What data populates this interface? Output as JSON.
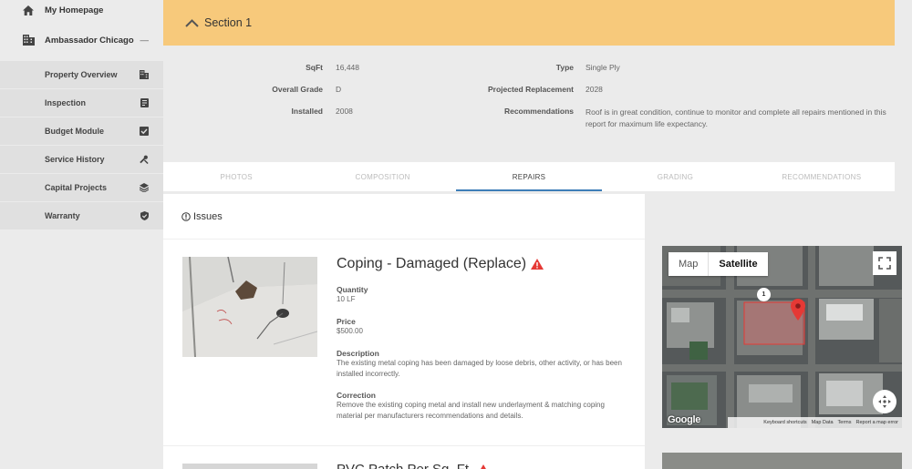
{
  "sidebar": {
    "top_items": [
      {
        "label": "My Homepage",
        "icon": "home-icon"
      },
      {
        "label": "Ambassador Chicago",
        "icon": "building-icon",
        "toggle": "—"
      }
    ],
    "items": [
      {
        "label": "Property Overview",
        "icon": "building-small-icon"
      },
      {
        "label": "Inspection",
        "icon": "clipboard-icon"
      },
      {
        "label": "Budget Module",
        "icon": "checkbox-icon"
      },
      {
        "label": "Service History",
        "icon": "wrench-icon"
      },
      {
        "label": "Capital Projects",
        "icon": "layers-icon"
      },
      {
        "label": "Warranty",
        "icon": "shield-check-icon"
      }
    ]
  },
  "section": {
    "title": "Section 1",
    "header_color": "#f7c97b"
  },
  "details": {
    "sqft_label": "SqFt",
    "sqft_value": "16,448",
    "grade_label": "Overall Grade",
    "grade_value": "D",
    "installed_label": "Installed",
    "installed_value": "2008",
    "type_label": "Type",
    "type_value": "Single Ply",
    "replacement_label": "Projected Replacement",
    "replacement_value": "2028",
    "recommendations_label": "Recommendations",
    "recommendations_value": "Roof is in great condition, continue to monitor and complete all repairs mentioned in this report for maximum life expectancy."
  },
  "tabs": [
    {
      "label": "PHOTOS",
      "active": false
    },
    {
      "label": "COMPOSITION",
      "active": false
    },
    {
      "label": "REPAIRS",
      "active": true
    },
    {
      "label": "GRADING",
      "active": false
    },
    {
      "label": "RECOMMENDATIONS",
      "active": false
    }
  ],
  "issues": {
    "heading": "Issues",
    "items": [
      {
        "title": "Coping - Damaged (Replace)",
        "quantity_label": "Quantity",
        "quantity": "10 LF",
        "price_label": "Price",
        "price": "$500.00",
        "description_label": "Description",
        "description": "The existing metal coping has been damaged by loose debris, other activity, or has been installed incorrectly.",
        "correction_label": "Correction",
        "correction": "Remove the existing coping metal and install new underlayment & matching coping material per manufacturers recommendations and details."
      },
      {
        "title": "PVC Patch Per Sq. Ft."
      }
    ]
  },
  "map": {
    "map_label": "Map",
    "satellite_label": "Satellite",
    "marker_label": "1",
    "google": "Google",
    "footer": [
      "Keyboard shortcuts",
      "Map Data",
      "Terms",
      "Report a map error"
    ]
  },
  "colors": {
    "accent": "#3d7eb8",
    "warning": "#e53935",
    "marker": "#e53935"
  }
}
